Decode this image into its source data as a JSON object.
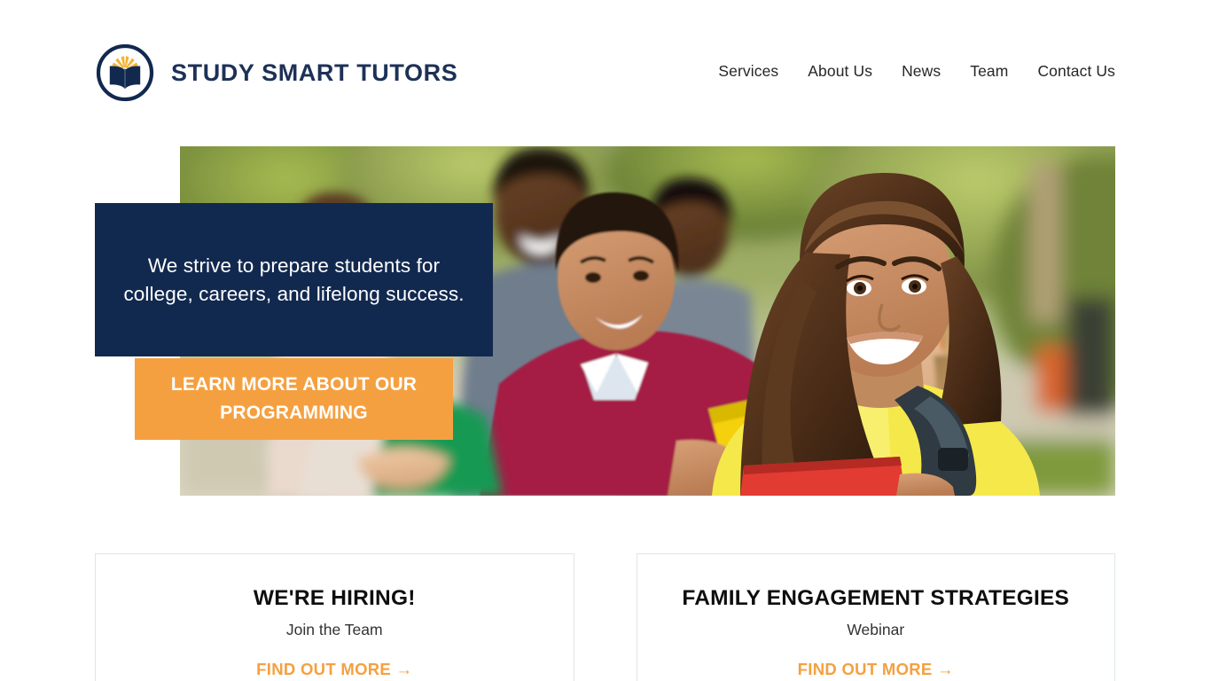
{
  "brand": {
    "name": "STUDY SMART TUTORS",
    "logo_icon": "open-book-in-circle-icon",
    "navy": "#1d3157",
    "gold": "#f5b335"
  },
  "nav": {
    "items": [
      {
        "label": "Services"
      },
      {
        "label": "About Us"
      },
      {
        "label": "News"
      },
      {
        "label": "Team"
      },
      {
        "label": "Contact Us"
      }
    ]
  },
  "hero": {
    "photo_alt": "Group of smiling high school students walking outdoors on campus",
    "callout_text": "We strive to prepare students for college, careers, and lifelong success.",
    "cta_label": "LEARN MORE ABOUT OUR PROGRAMMING",
    "callout_bg": "#12294f",
    "cta_bg": "#f5a040"
  },
  "cards": [
    {
      "title": "WE'RE HIRING!",
      "subtitle": "Join the Team",
      "link_label": "FIND OUT MORE →"
    },
    {
      "title": "FAMILY ENGAGEMENT STRATEGIES",
      "subtitle": "Webinar",
      "link_label": "FIND OUT MORE →"
    }
  ]
}
